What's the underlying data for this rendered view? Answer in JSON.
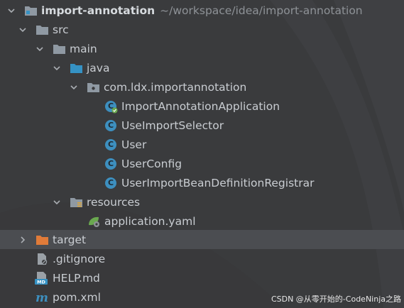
{
  "tree": {
    "root": {
      "name": "import-annotation",
      "path": "~/workspace/idea/import-annotation"
    },
    "src": "src",
    "main": "main",
    "java": "java",
    "package": "com.ldx.importannotation",
    "classes": [
      "ImportAnnotationApplication",
      "UseImportSelector",
      "User",
      "UserConfig",
      "UserImportBeanDefinitionRegistrar"
    ],
    "resources": "resources",
    "yaml": "application.yaml",
    "target": "target",
    "gitignore": ".gitignore",
    "help": "HELP.md",
    "pom": "pom.xml"
  },
  "watermark": "CSDN @从零开始的-CodeNinja之路",
  "colors": {
    "background": "#3a3b3d",
    "selection": "#4b4d51",
    "folder": "#8f99a3",
    "java_folder": "#3592c4",
    "target_folder": "#e07b39",
    "class_icon": "#3d8fbf"
  }
}
